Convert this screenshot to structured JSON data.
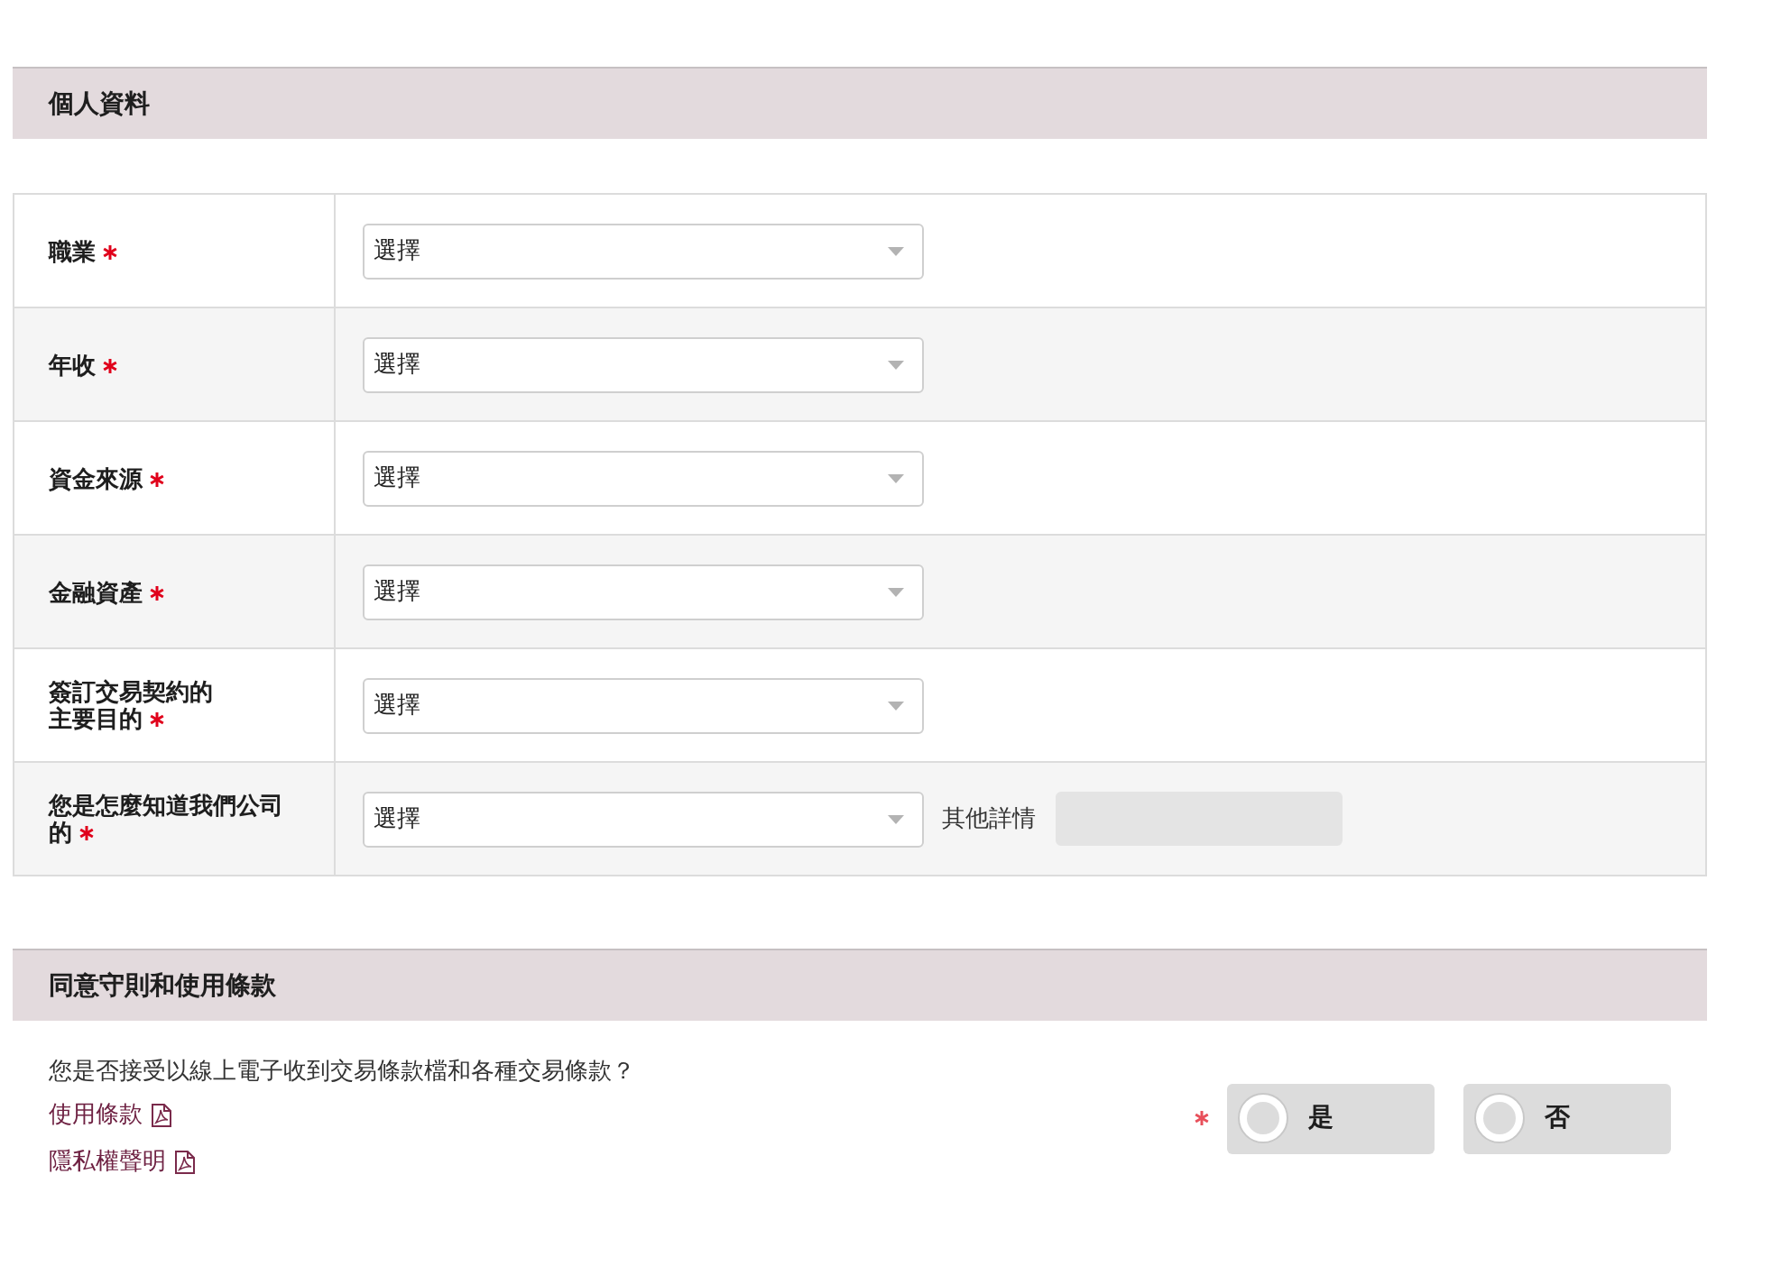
{
  "sections": [
    {
      "kind": "fields",
      "title": "個人資料",
      "fields": [
        {
          "label_lines": [
            "職業"
          ],
          "required": true,
          "placeholder": "選擇"
        },
        {
          "label_lines": [
            "年收"
          ],
          "required": true,
          "placeholder": "選擇"
        },
        {
          "label_lines": [
            "資金來源"
          ],
          "required": true,
          "placeholder": "選擇"
        },
        {
          "label_lines": [
            "金融資產"
          ],
          "required": true,
          "placeholder": "選擇"
        },
        {
          "label_lines": [
            "簽訂交易契約的",
            "主要目的"
          ],
          "required": true,
          "placeholder": "選擇"
        },
        {
          "label_lines": [
            "您是怎麼知道我們公司的"
          ],
          "required": true,
          "placeholder": "選擇",
          "extra": {
            "label": "其他詳情",
            "disabled": true
          }
        }
      ]
    },
    {
      "kind": "consent",
      "title": "同意守則和使用條款",
      "question": "您是否接受以線上電子收到交易條款檔和各種交易條款？",
      "links": [
        {
          "label": "使用條款"
        },
        {
          "label": "隱私權聲明"
        }
      ],
      "required": true,
      "options": [
        {
          "label": "是",
          "selected": false
        },
        {
          "label": "否",
          "selected": false
        }
      ]
    }
  ]
}
